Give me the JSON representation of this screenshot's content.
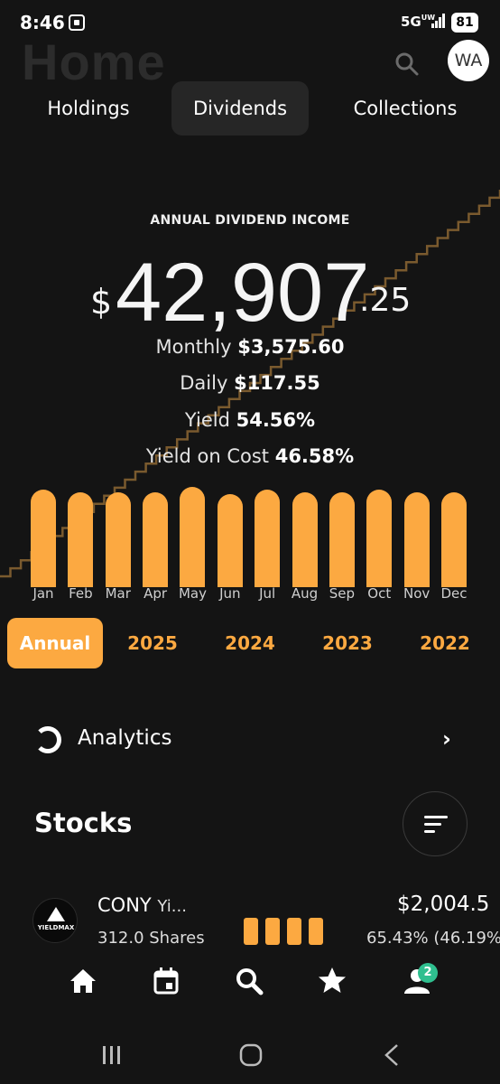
{
  "status_bar": {
    "time": "8:46",
    "network": "5G",
    "network_sub": "UW",
    "battery": "81"
  },
  "header": {
    "title": "Home",
    "avatar_initials": "WA"
  },
  "tabs": [
    {
      "label": "Holdings",
      "active": false
    },
    {
      "label": "Dividends",
      "active": true
    },
    {
      "label": "Collections",
      "active": false
    }
  ],
  "income": {
    "label": "ANNUAL DIVIDEND INCOME",
    "currency_symbol": "$",
    "amount_integer": "42,907",
    "amount_cents": ".25",
    "monthly_label": "Monthly",
    "monthly_value": "$3,575.60",
    "daily_label": "Daily",
    "daily_value": "$117.55",
    "yield_label": "Yield",
    "yield_value": "54.56%",
    "yoc_label": "Yield on Cost",
    "yoc_value": "46.58%"
  },
  "chart_data": {
    "type": "bar",
    "categories": [
      "Jan",
      "Feb",
      "Mar",
      "Apr",
      "May",
      "Jun",
      "Jul",
      "Aug",
      "Sep",
      "Oct",
      "Nov",
      "Dec"
    ],
    "values": [
      0.96,
      0.94,
      0.94,
      0.94,
      0.99,
      0.92,
      0.96,
      0.94,
      0.94,
      0.96,
      0.94,
      0.94
    ],
    "bar_color": "#fca941"
  },
  "years": [
    {
      "label": "Annual",
      "active": true
    },
    {
      "label": "2025",
      "active": false
    },
    {
      "label": "2024",
      "active": false
    },
    {
      "label": "2023",
      "active": false
    },
    {
      "label": "2022",
      "active": false
    }
  ],
  "analytics": {
    "label": "Analytics",
    "icon": "donut-chart-icon"
  },
  "stocks": {
    "title": "Stocks",
    "holdings": [
      {
        "ticker": "CONY",
        "name_truncated": "Yi...",
        "logo_text": "YIELDMAX",
        "shares": "312.0 Shares",
        "value": "$2,004.5",
        "pct": "65.43% (46.19%"
      }
    ]
  },
  "bottom_nav": {
    "items": [
      "home-icon",
      "calendar-icon",
      "search-icon",
      "star-icon",
      "profile-icon"
    ],
    "badge": "2"
  },
  "colors": {
    "accent": "#fca941",
    "background": "#141414",
    "badge": "#2fbf8f",
    "line": "#7a5a2e"
  }
}
